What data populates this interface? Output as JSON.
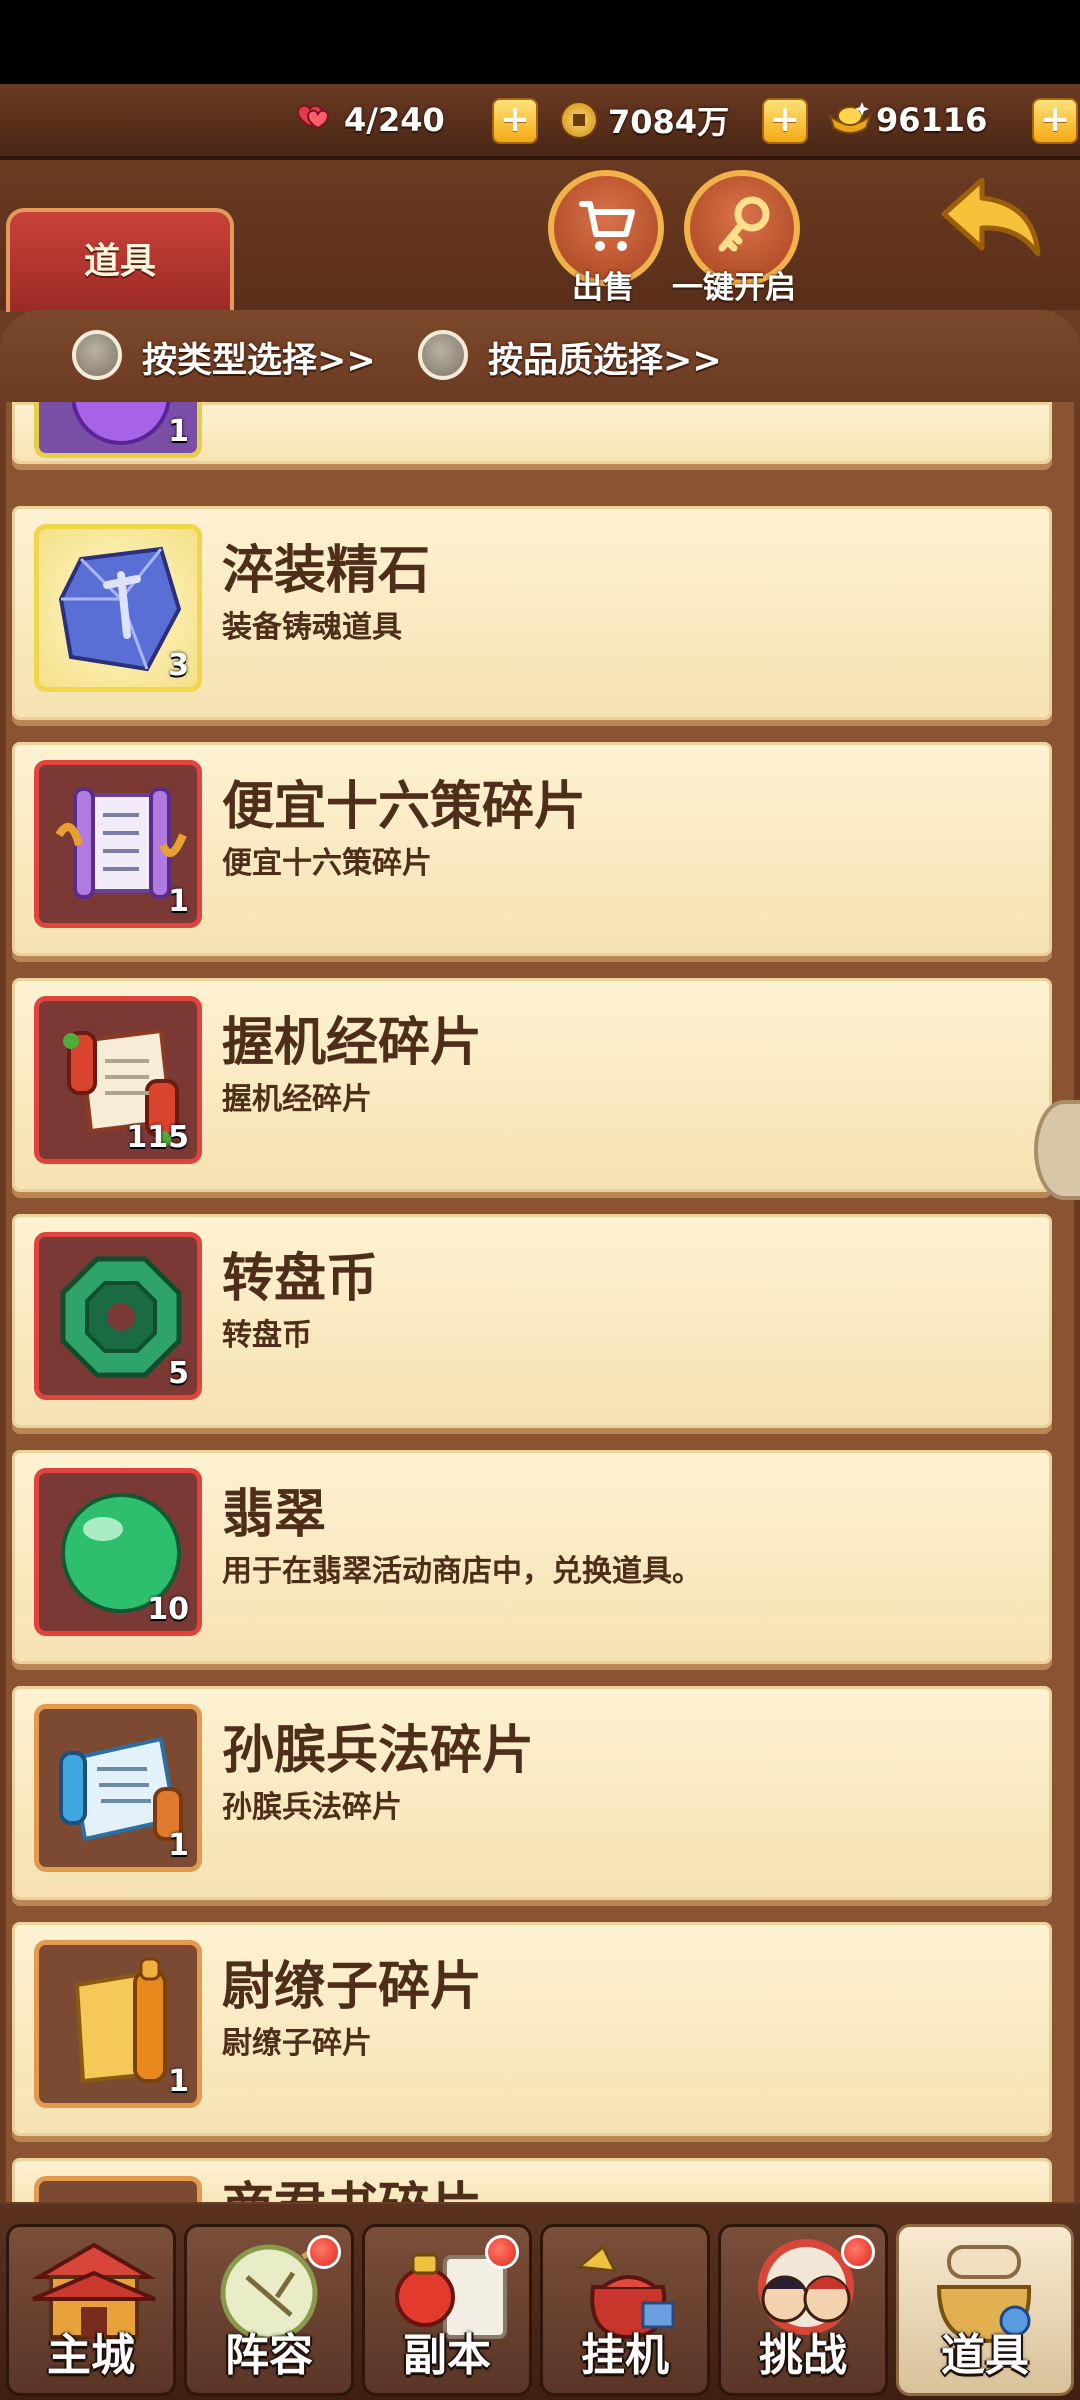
{
  "resources": {
    "stamina": "4/240",
    "coins": "7084万",
    "ingots": "96116"
  },
  "header": {
    "tab_label": "道具",
    "sell_label": "出售",
    "open_all_label": "一键开启"
  },
  "filters": {
    "by_type": "按类型选择>>",
    "by_quality": "按品质选择>>"
  },
  "partial_top_item": {
    "qty": "1"
  },
  "items": [
    {
      "name": "淬装精石",
      "desc": "装备铸魂道具",
      "qty": "3",
      "icon": "crystal-stone-icon",
      "frame": "gold"
    },
    {
      "name": "便宜十六策碎片",
      "desc": "便宜十六策碎片",
      "qty": "1",
      "icon": "purple-scroll-icon",
      "frame": "red"
    },
    {
      "name": "握机经碎片",
      "desc": "握机经碎片",
      "qty": "115",
      "icon": "red-scroll-icon",
      "frame": "red"
    },
    {
      "name": "转盘币",
      "desc": "转盘币",
      "qty": "5",
      "icon": "jade-coin-icon",
      "frame": "red"
    },
    {
      "name": "翡翠",
      "desc": "用于在翡翠活动商店中，兑换道具。",
      "qty": "10",
      "icon": "jade-orb-icon",
      "frame": "red"
    },
    {
      "name": "孙膑兵法碎片",
      "desc": "孙膑兵法碎片",
      "qty": "1",
      "icon": "blue-scroll-icon",
      "frame": "orange"
    },
    {
      "name": "尉缭子碎片",
      "desc": "尉缭子碎片",
      "qty": "1",
      "icon": "gold-scroll-icon",
      "frame": "orange"
    }
  ],
  "partial_bottom_item": {
    "name": "商君书碎片"
  },
  "nav": [
    {
      "label": "主城",
      "icon": "castle-icon",
      "badge": false,
      "active": false
    },
    {
      "label": "阵容",
      "icon": "fan-icon",
      "badge": true,
      "active": false
    },
    {
      "label": "副本",
      "icon": "dungeon-icon",
      "badge": true,
      "active": false
    },
    {
      "label": "挂机",
      "icon": "treasure-bag-icon",
      "badge": false,
      "active": false
    },
    {
      "label": "挑战",
      "icon": "challenge-icon",
      "badge": true,
      "active": false
    },
    {
      "label": "道具",
      "icon": "items-bag-icon",
      "badge": false,
      "active": true
    }
  ],
  "colors": {
    "wood": "#6b3b22",
    "parchment": "#fdf2d2",
    "item_text": "#4e2d1b",
    "gold_button": "#f3a913",
    "red_tab": "#c9423a"
  }
}
